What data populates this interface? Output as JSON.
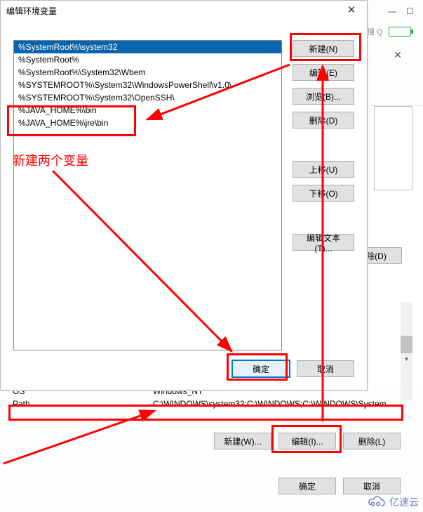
{
  "dialog": {
    "title": "编辑环境变量",
    "close_glyph": "✕",
    "entries": [
      "%SystemRoot%\\system32",
      "%SystemRoot%",
      "%SystemRoot%\\System32\\Wbem",
      "%SYSTEMROOT%\\System32\\WindowsPowerShell\\v1.0\\",
      "%SYSTEMROOT%\\System32\\OpenSSH\\",
      "%JAVA_HOME%\\bin",
      "%JAVA_HOME%\\jre\\bin"
    ],
    "selected_index": 0,
    "buttons": {
      "new": "新建(N)",
      "edit": "编辑(E)",
      "browse": "浏览(B)...",
      "delete": "删除(D)",
      "move_up": "上移(U)",
      "move_down": "下移(O)",
      "edit_text": "编辑文本(T)...",
      "ok": "确定",
      "cancel": "取消"
    }
  },
  "parent": {
    "sys_rows": [
      {
        "name": "OS",
        "value": "Windows_NT"
      },
      {
        "name": "Path",
        "value": "C:\\WINDOWS\\system32;C:\\WINDOWS;C:\\WINDOWS\\System..."
      }
    ],
    "buttons": {
      "new": "新建(W)...",
      "edit": "编辑(I)...",
      "delete": "删除(L)",
      "delete_d": "删除(D)",
      "ok": "确定",
      "cancel": "取消"
    },
    "search_hint": "搜 Q"
  },
  "annotations": {
    "note_text": "新建两个变量"
  },
  "watermark": "亿速云"
}
